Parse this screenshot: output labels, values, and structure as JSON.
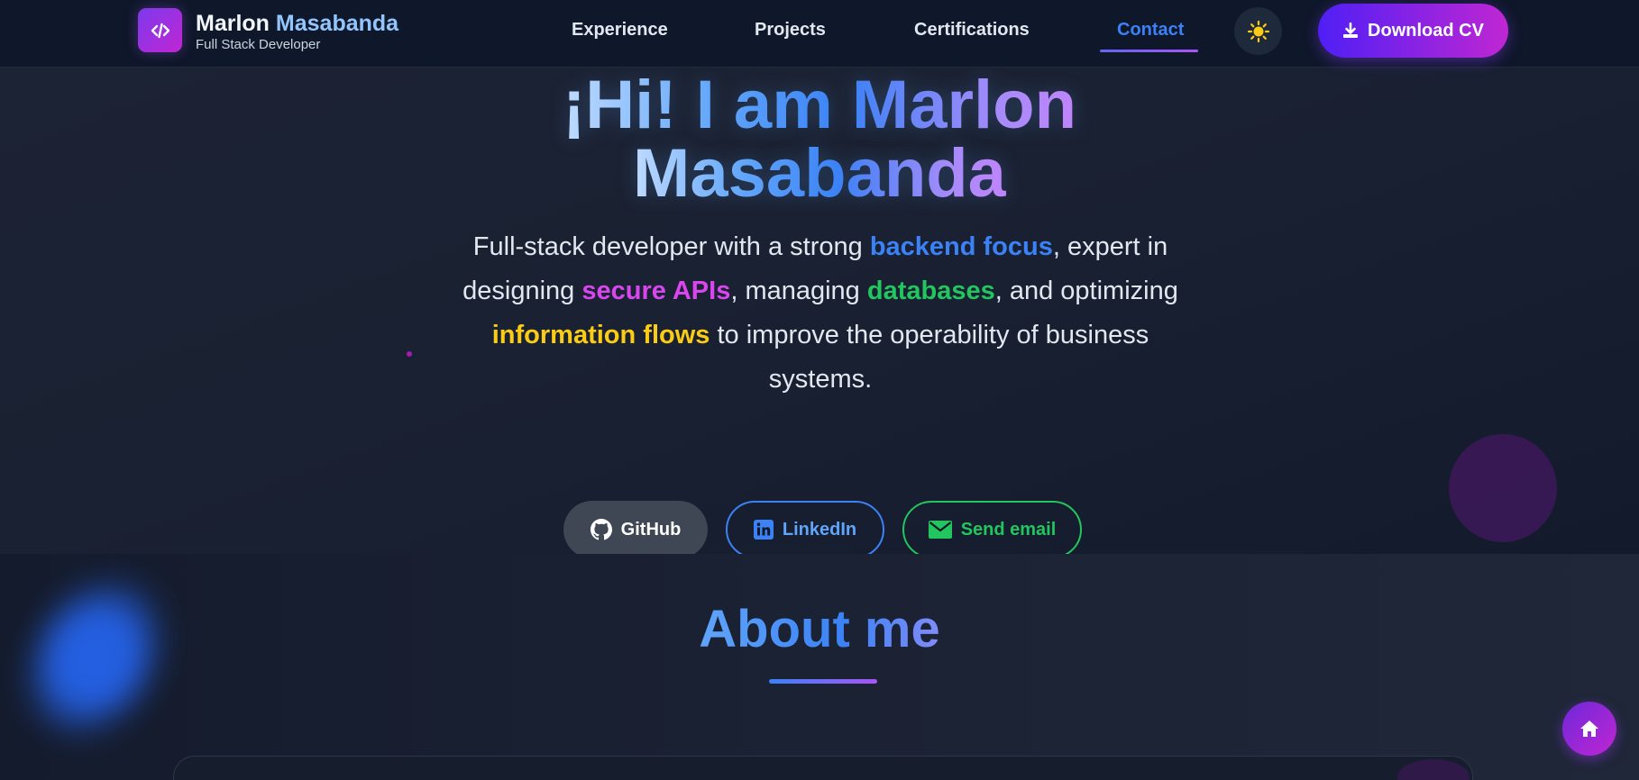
{
  "nav": {
    "brand_first": "Marlon",
    "brand_last": "Masabanda",
    "brand_subtitle": "Full Stack Developer",
    "logo_icon": "code-icon",
    "links": [
      {
        "label": "Experience"
      },
      {
        "label": "Projects"
      },
      {
        "label": "Certifications"
      },
      {
        "label": "Contact"
      }
    ],
    "active_link": "Contact",
    "theme_icon": "sun-icon",
    "download_cv_label": "Download CV",
    "download_icon": "download-icon"
  },
  "hero": {
    "title_line1": "¡Hi! I am Marlon",
    "title_line2": "Masabanda",
    "desc_1": "Full-stack developer with a strong ",
    "hl_1": "backend focus",
    "desc_2": ", expert in designing ",
    "hl_2": "secure APIs",
    "desc_3": ", managing ",
    "hl_3": "databases",
    "desc_4": ", and optimizing ",
    "hl_4": "information flows",
    "desc_5": " to improve the operability of business systems.",
    "buttons": {
      "github": "GitHub",
      "linkedin": "LinkedIn",
      "email": "Send email"
    }
  },
  "about": {
    "title": "About me"
  },
  "fab": {
    "icon": "home-icon"
  },
  "colors": {
    "accent_blue": "#3b82f6",
    "accent_purple": "#a855f7",
    "accent_pink": "#d946ef",
    "accent_green": "#22c55e",
    "accent_yellow": "#facc15",
    "background": "#111827"
  }
}
